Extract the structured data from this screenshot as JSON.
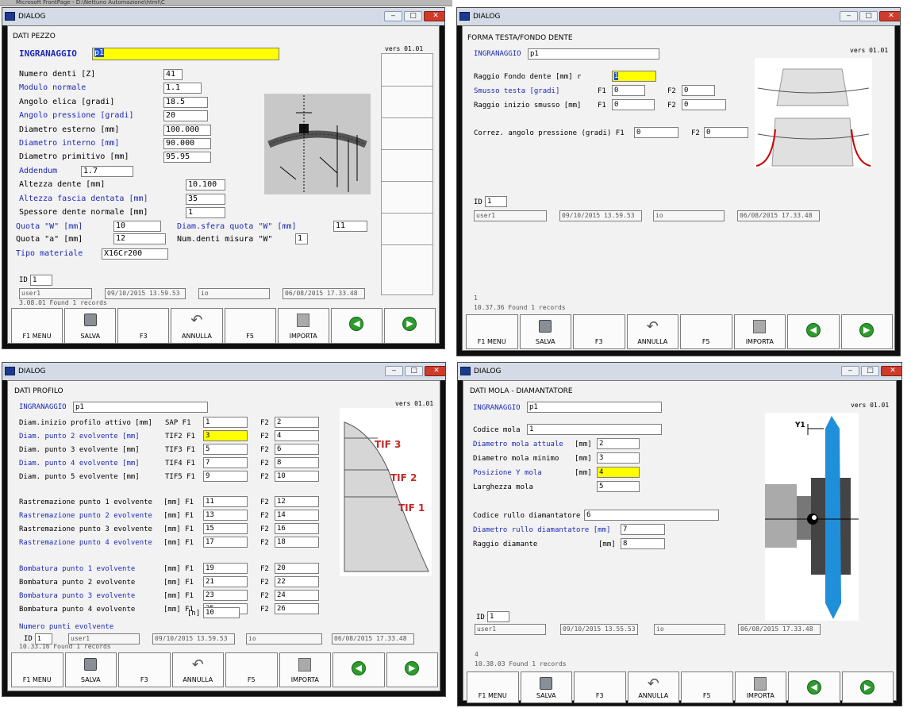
{
  "top_strip": "Microsoft FrontPage - D:\\Nettuno Automazione\\html\\C",
  "w1": {
    "title": "DIALOG",
    "section": "DATI PEZZO",
    "vers": "vers 01.01",
    "ingranaggio_label": "INGRANAGGIO",
    "ingranaggio_value": "p1",
    "rows": [
      {
        "label": "Numero denti [Z]",
        "value": "41"
      },
      {
        "label": "Modulo normale",
        "value": "1.1"
      },
      {
        "label": "Angolo elica [gradi]",
        "value": "18.5"
      },
      {
        "label": "Angolo pressione [gradi]",
        "value": "20"
      },
      {
        "label": "Diametro esterno [mm]",
        "value": "100.000"
      },
      {
        "label": "Diametro interno [mm]",
        "value": "90.000"
      },
      {
        "label": "Diametro primitivo [mm]",
        "value": "95.95"
      },
      {
        "label": "Addendum",
        "value": "1.7"
      },
      {
        "label": "Altezza dente [mm]",
        "value": "10.100"
      },
      {
        "label": "Altezza fascia dentata [mm]",
        "value": "35"
      },
      {
        "label": "Spessore dente normale [mm]",
        "value": "1"
      }
    ],
    "quota_w_label": "Quota \"W\" [mm]",
    "quota_w_value": "10",
    "diam_sfera_label": "Diam.sfera quota \"W\" [mm]",
    "diam_sfera_value": "11",
    "quota_a_label": "Quota \"a\" [mm]",
    "quota_a_value": "12",
    "num_denti_label": "Num.denti misura \"W\"",
    "num_denti_value": "1",
    "tipo_materiale_label": "Tipo materiale",
    "tipo_materiale_value": "X16Cr200",
    "id_label": "ID",
    "id_value": "1",
    "meta": [
      "user1",
      "09/10/2015 13.59.53",
      "io",
      "06/08/2015 17.33.48"
    ],
    "status": "3.08.01 Found 1 records",
    "fkeys": [
      "F1 MENU",
      "SALVA",
      "F3",
      "ANNULLA",
      "F5",
      "IMPORTA",
      "",
      ""
    ]
  },
  "w2": {
    "title": "DIALOG",
    "section": "FORMA TESTA/FONDO DENTE",
    "vers": "vers 01.01",
    "ingranaggio_label": "INGRANAGGIO",
    "ingranaggio_value": "p1",
    "raggio_label": "Raggio Fondo dente [mm] r",
    "raggio_value": "1",
    "smusso_label": "Smusso testa [gradi]",
    "smusso_f1": "0",
    "smusso_f2": "0",
    "raggio_smusso_label": "Raggio inizio smusso [mm]",
    "raggio_smusso_f1": "0",
    "raggio_smusso_f2": "0",
    "correz_label": "Correz. angolo pressione (gradi) F1",
    "correz_f1": "0",
    "correz_f2": "0",
    "f1": "F1",
    "f2": "F2",
    "id_label": "ID",
    "id_value": "1",
    "meta": [
      "user1",
      "09/10/2015 13.59.53",
      "io",
      "06/08/2015 17.33.48"
    ],
    "rec": "1",
    "status": "10.37.36 Found 1 records",
    "fkeys": [
      "F1 MENU",
      "SALVA",
      "F3",
      "ANNULLA",
      "F5",
      "IMPORTA",
      "",
      ""
    ]
  },
  "w3": {
    "title": "DIALOG",
    "section": "DATI PROFILO",
    "vers": "vers 01.01",
    "ingranaggio_label": "INGRANAGGIO",
    "ingranaggio_value": "p1",
    "g1": [
      {
        "label": "Diam.inizio profilo attivo [mm]",
        "tag": "SAP F1",
        "v1": "1",
        "v2": "2",
        "blue": false
      },
      {
        "label": "Diam. punto 2 evolvente [mm]",
        "tag": "TIF2 F1",
        "v1": "3",
        "v2": "4",
        "blue": true
      },
      {
        "label": "Diam. punto 3 evolvente [mm]",
        "tag": "TIF3 F1",
        "v1": "5",
        "v2": "6",
        "blue": false
      },
      {
        "label": "Diam. punto 4 evolvente [mm]",
        "tag": "TIF4 F1",
        "v1": "7",
        "v2": "8",
        "blue": true
      },
      {
        "label": "Diam. punto 5 evolvente [mm]",
        "tag": "TIF5 F1",
        "v1": "9",
        "v2": "10",
        "blue": false
      }
    ],
    "g2": [
      {
        "label": "Rastremazione punto 1 evolvente",
        "tag": "[mm] F1",
        "v1": "11",
        "v2": "12",
        "blue": false
      },
      {
        "label": "Rastremazione punto 2 evolvente",
        "tag": "[mm] F1",
        "v1": "13",
        "v2": "14",
        "blue": true
      },
      {
        "label": "Rastremazione punto 3 evolvente",
        "tag": "[mm] F1",
        "v1": "15",
        "v2": "16",
        "blue": false
      },
      {
        "label": "Rastremazione punto 4 evolvente",
        "tag": "[mm] F1",
        "v1": "17",
        "v2": "18",
        "blue": true
      }
    ],
    "g3": [
      {
        "label": "Bombatura punto 1 evolvente",
        "tag": "[mm] F1",
        "v1": "19",
        "v2": "20",
        "blue": true
      },
      {
        "label": "Bombatura punto 2 evolvente",
        "tag": "[mm] F1",
        "v1": "21",
        "v2": "22",
        "blue": false
      },
      {
        "label": "Bombatura punto 3 evolvente",
        "tag": "[mm] F1",
        "v1": "23",
        "v2": "24",
        "blue": true
      },
      {
        "label": "Bombatura punto 4 evolvente",
        "tag": "[mm] F1",
        "v1": "25",
        "v2": "26",
        "blue": false
      }
    ],
    "f2": "F2",
    "numero_label": "Numero punti evolvente",
    "numero_unit": "[n]",
    "numero_value": "10",
    "tif": [
      "TIF 3",
      "TIF 2",
      "TIF 1"
    ],
    "id_label": "ID",
    "id_value": "1",
    "meta": [
      "user1",
      "09/10/2015 13.59.53",
      "io",
      "06/08/2015 17.33.48"
    ],
    "status": "10.33.16 Found 1 records",
    "fkeys": [
      "F1 MENU",
      "SALVA",
      "F3",
      "ANNULLA",
      "F5",
      "IMPORTA",
      "",
      ""
    ]
  },
  "w4": {
    "title": "DIALOG",
    "section": "DATI MOLA - DIAMANTATORE",
    "vers": "vers 01.01",
    "ingranaggio_label": "INGRANAGGIO",
    "ingranaggio_value": "p1",
    "rows": [
      {
        "label": "Codice mola",
        "unit": "",
        "value": "1",
        "blue": false,
        "wide": true
      },
      {
        "label": "Diametro mola attuale",
        "unit": "[mm]",
        "value": "2",
        "blue": true
      },
      {
        "label": "Diametro mola minimo",
        "unit": "[mm]",
        "value": "3",
        "blue": false
      },
      {
        "label": "Posizione Y mola",
        "unit": "[mm]",
        "value": "4",
        "blue": true,
        "yel": true
      },
      {
        "label": "Larghezza mola",
        "unit": "",
        "value": "5",
        "blue": false
      }
    ],
    "rullo_label": "Codice rullo diamantatore",
    "rullo_value": "6",
    "diam_rullo_label": "Diametro rullo diamantatore [mm]",
    "diam_rullo_value": "7",
    "raggio_label": "Raggio diamante",
    "raggio_unit": "[mm]",
    "raggio_value": "8",
    "y1": "Y1",
    "id_label": "ID",
    "id_value": "1",
    "meta": [
      "user1",
      "09/10/2015 13.55.53",
      "io",
      "06/08/2015 17.33.48"
    ],
    "rec": "4",
    "status": "10.38.03 Found 1 records",
    "fkeys": [
      "F1 MENU",
      "SALVA",
      "F3",
      "ANNULLA",
      "F5",
      "IMPORTA",
      "",
      ""
    ]
  }
}
